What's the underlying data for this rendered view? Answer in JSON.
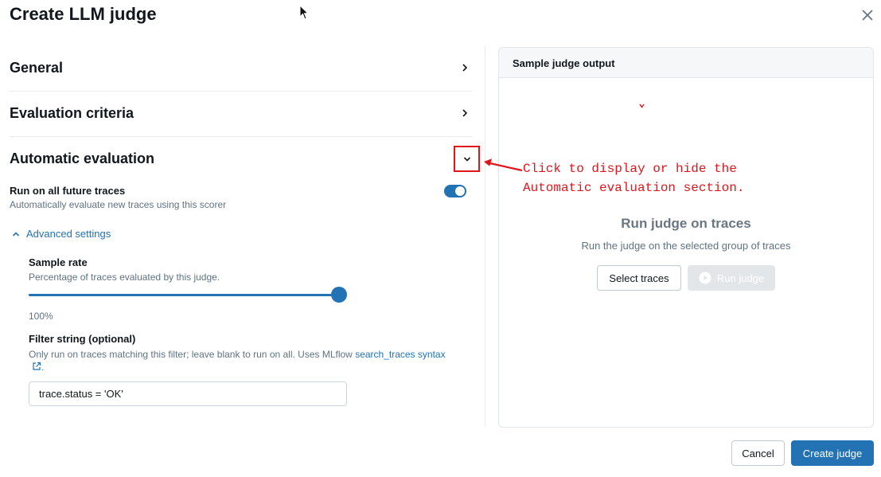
{
  "dialog": {
    "title": "Create LLM judge"
  },
  "sections": {
    "general": {
      "label": "General",
      "expanded": false
    },
    "evaluation_criteria": {
      "label": "Evaluation criteria",
      "expanded": false
    },
    "automatic_evaluation": {
      "label": "Automatic evaluation",
      "expanded": true
    }
  },
  "auto_eval": {
    "toggle_title": "Run on all future traces",
    "toggle_desc": "Automatically evaluate new traces using this scorer",
    "toggle_on": true,
    "advanced_label": "Advanced settings",
    "sample_rate": {
      "title": "Sample rate",
      "desc": "Percentage of traces evaluated by this judge.",
      "value": 100,
      "value_text": "100%"
    },
    "filter": {
      "title": "Filter string (optional)",
      "desc": "Only run on traces matching this filter; leave blank to run on all. Uses MLflow ",
      "link": "search_traces syntax",
      "suffix": ".",
      "value": "trace.status = 'OK'"
    }
  },
  "output_panel": {
    "title": "Sample judge output",
    "run_title": "Run judge on traces",
    "run_desc": "Run the judge on the selected group of traces",
    "select_btn": "Select traces",
    "run_btn": "Run judge"
  },
  "annotation": {
    "text": "Click to display or hide the\nAutomatic evaluation section.",
    "color": "#e0151b"
  },
  "footer": {
    "cancel": "Cancel",
    "create": "Create judge"
  },
  "colors": {
    "accent": "#2272b4",
    "annotation": "#e0151b"
  }
}
